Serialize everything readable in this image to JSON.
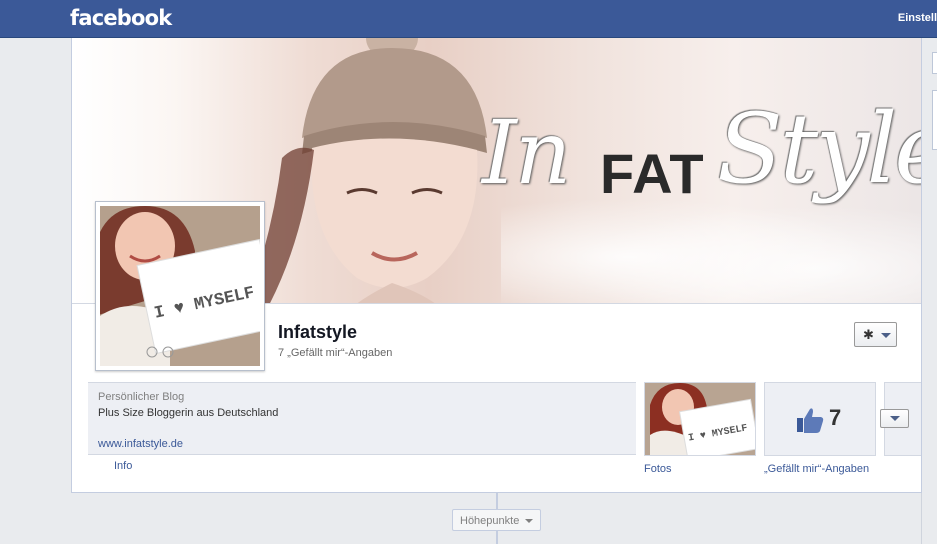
{
  "topbar": {
    "logo": "facebook",
    "settings_link": "Einstell"
  },
  "cover": {
    "title_in": "In",
    "title_fat": "FAT",
    "title_style": "Style"
  },
  "profile_picture": {
    "sign_text": "I ♥ MYSELF"
  },
  "page": {
    "name": "Infatstyle",
    "likes_line": "7 „Gefällt mir“-Angaben"
  },
  "info": {
    "category": "Persönlicher Blog",
    "description": "Plus Size Bloggerin aus Deutschland",
    "url": "www.infatstyle.de",
    "tab_label": "Info"
  },
  "apps": {
    "photos_label": "Fotos",
    "photos_sign_text": "I ♥ MYSELF",
    "likes_count": "7",
    "likes_label": "„Gefällt mir“-Angaben"
  },
  "timeline": {
    "highlights_label": "Höhepunkte"
  },
  "icons": {
    "gear": "gear-icon",
    "caret": "chevron-down-icon",
    "like": "thumbs-up-icon"
  },
  "colors": {
    "brand_blue": "#3b5998",
    "link_blue": "#3b5998"
  }
}
